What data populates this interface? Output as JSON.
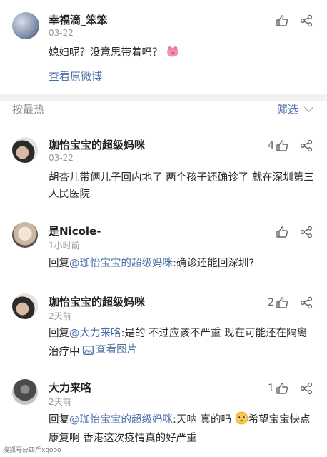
{
  "top_post": {
    "username": "幸福滴_笨笨",
    "time": "03-22",
    "text": "媳妇呢？没意思带着吗？",
    "view_original": "查看原微博",
    "emoji_icon": "pink-pig-emoji"
  },
  "sort_bar": {
    "sort_label": "按最热",
    "filter_label": "筛选"
  },
  "comments": [
    {
      "username": "珈怡宝宝的超级妈咪",
      "time": "03-22",
      "likes": "4",
      "text": "胡杏儿带俩儿子回内地了 两个孩子还确诊了 就在深圳第三人民医院"
    },
    {
      "username": "是Nicole-",
      "time": "1小时前",
      "likes": "",
      "reply_prefix": "回复",
      "reply_to": "@珈怡宝宝的超级妈咪",
      "text": ":确诊还能回深圳?"
    },
    {
      "username": "珈怡宝宝的超级妈咪",
      "time": "2天前",
      "likes": "2",
      "reply_prefix": "回复",
      "reply_to": "@大力来咯",
      "text": ":是的 不过应该不严重 现在可能还在隔离治疗中",
      "view_image": "查看图片"
    },
    {
      "username": "大力来咯",
      "time": "2天前",
      "likes": "1",
      "reply_prefix": "回复",
      "reply_to": "@珈怡宝宝的超级妈咪",
      "text_before_emoji": ":天呐 真的吗",
      "text_after_emoji": "希望宝宝快点康复啊 香港这次疫情真的好严重",
      "emoji_icon": "pleading-face-emoji"
    }
  ],
  "watermark": "搜狐号@四斤xgooo"
}
